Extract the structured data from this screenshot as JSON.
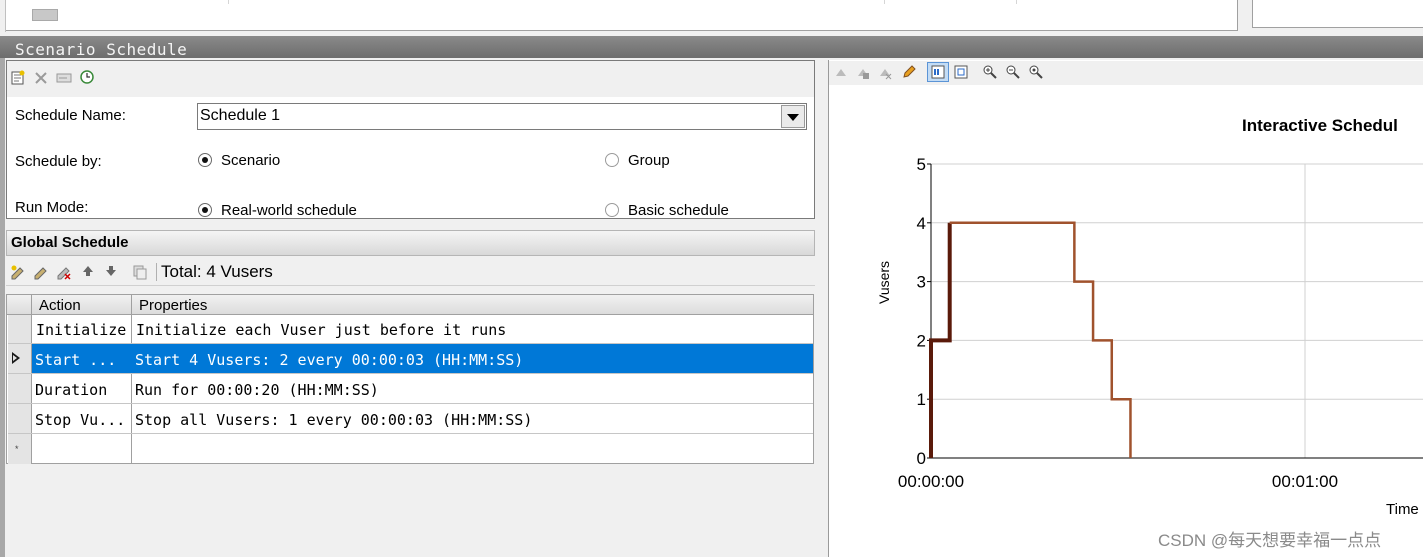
{
  "title_bar": {
    "title": "Scenario Schedule"
  },
  "settings": {
    "toolbar_icons": [
      "new-schedule-icon",
      "delete-icon",
      "rename-icon",
      "schedule-clock-icon"
    ],
    "schedule_name_label": "Schedule Name:",
    "schedule_name_value": "Schedule 1",
    "schedule_by_label": "Schedule by:",
    "schedule_by_options": [
      {
        "label": "Scenario",
        "selected": true
      },
      {
        "label": "Group",
        "selected": false
      }
    ],
    "run_mode_label": "Run Mode:",
    "run_mode_options": [
      {
        "label": "Real-world schedule",
        "selected": true
      },
      {
        "label": "Basic schedule",
        "selected": false
      }
    ]
  },
  "global_schedule": {
    "header": "Global Schedule",
    "toolbar_icons": [
      "add-action-icon",
      "edit-action-icon",
      "delete-action-icon",
      "move-up-icon",
      "move-down-icon",
      "copy-icon"
    ],
    "total": "Total: 4 Vusers",
    "columns": [
      "Action",
      "Properties"
    ],
    "rows": [
      {
        "action": "Initialize",
        "properties": "Initialize each Vuser just before it runs",
        "selected": false
      },
      {
        "action": "Start  ...",
        "properties": "Start 4 Vusers: 2 every 00:00:03 (HH:MM:SS)",
        "selected": true
      },
      {
        "action": "Duration",
        "properties": "Run for 00:00:20 (HH:MM:SS)",
        "selected": false
      },
      {
        "action": "Stop Vu...",
        "properties": "Stop all Vusers: 1 every 00:00:03 (HH:MM:SS)",
        "selected": false
      }
    ],
    "new_row_marker": "*"
  },
  "chart_toolbar_icons": [
    "graph-1-icon",
    "graph-2-icon",
    "graph-3-icon",
    "pencil-icon",
    "legend-icon",
    "fit-icon",
    "zoom-in-icon",
    "zoom-out-icon",
    "zoom-reset-icon"
  ],
  "chart_data": {
    "type": "line",
    "title": "Interactive Schedul",
    "xlabel": "Time",
    "ylabel": "Vusers",
    "y_ticks": [
      "0",
      "1",
      "2",
      "3",
      "4",
      "5"
    ],
    "x_ticks": [
      "00:00:00",
      "00:01:00"
    ],
    "ylim": [
      0,
      5
    ],
    "xlim_seconds": [
      0,
      60
    ],
    "grid": true,
    "series": [
      {
        "color": "#5a1a0a",
        "points": [
          [
            0,
            0
          ],
          [
            0,
            2
          ],
          [
            3,
            2
          ],
          [
            3,
            4
          ]
        ]
      },
      {
        "color": "#a0522d",
        "points": [
          [
            3,
            4
          ],
          [
            23,
            4
          ],
          [
            23,
            3
          ],
          [
            26,
            3
          ],
          [
            26,
            2
          ],
          [
            29,
            2
          ],
          [
            29,
            1
          ],
          [
            32,
            1
          ],
          [
            32,
            0
          ]
        ]
      }
    ]
  },
  "watermark": "CSDN @每天想要幸福一点点",
  "colors": {
    "selection": "#0078d7",
    "title_bar": "#7a7a7a"
  }
}
